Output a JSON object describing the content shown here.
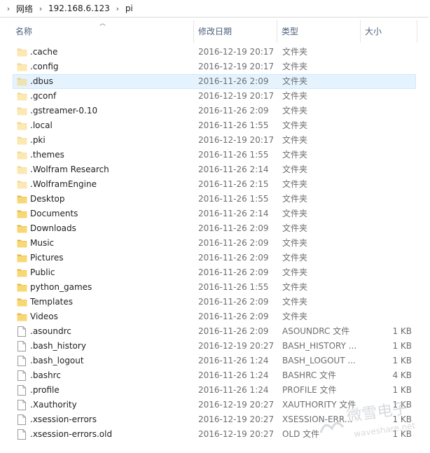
{
  "breadcrumb": {
    "items": [
      "网络",
      "192.168.6.123",
      "pi"
    ]
  },
  "columns": {
    "name": "名称",
    "date": "修改日期",
    "type": "类型",
    "size": "大小"
  },
  "selected_index": 2,
  "files": [
    {
      "icon": "folder-icon",
      "hidden": true,
      "name": ".cache",
      "date": "2016-12-19 20:17",
      "type": "文件夹",
      "size": ""
    },
    {
      "icon": "folder-icon",
      "hidden": true,
      "name": ".config",
      "date": "2016-12-19 20:17",
      "type": "文件夹",
      "size": ""
    },
    {
      "icon": "folder-icon",
      "hidden": true,
      "name": ".dbus",
      "date": "2016-11-26 2:09",
      "type": "文件夹",
      "size": ""
    },
    {
      "icon": "folder-icon",
      "hidden": true,
      "name": ".gconf",
      "date": "2016-12-19 20:17",
      "type": "文件夹",
      "size": ""
    },
    {
      "icon": "folder-icon",
      "hidden": true,
      "name": ".gstreamer-0.10",
      "date": "2016-11-26 2:09",
      "type": "文件夹",
      "size": ""
    },
    {
      "icon": "folder-icon",
      "hidden": true,
      "name": ".local",
      "date": "2016-11-26 1:55",
      "type": "文件夹",
      "size": ""
    },
    {
      "icon": "folder-icon",
      "hidden": true,
      "name": ".pki",
      "date": "2016-12-19 20:17",
      "type": "文件夹",
      "size": ""
    },
    {
      "icon": "folder-icon",
      "hidden": true,
      "name": ".themes",
      "date": "2016-11-26 1:55",
      "type": "文件夹",
      "size": ""
    },
    {
      "icon": "folder-icon",
      "hidden": true,
      "name": ".Wolfram Research",
      "date": "2016-11-26 2:14",
      "type": "文件夹",
      "size": ""
    },
    {
      "icon": "folder-icon",
      "hidden": true,
      "name": ".WolframEngine",
      "date": "2016-11-26 2:15",
      "type": "文件夹",
      "size": ""
    },
    {
      "icon": "folder-icon",
      "hidden": false,
      "name": "Desktop",
      "date": "2016-11-26 1:55",
      "type": "文件夹",
      "size": ""
    },
    {
      "icon": "folder-icon",
      "hidden": false,
      "name": "Documents",
      "date": "2016-11-26 2:14",
      "type": "文件夹",
      "size": ""
    },
    {
      "icon": "folder-icon",
      "hidden": false,
      "name": "Downloads",
      "date": "2016-11-26 2:09",
      "type": "文件夹",
      "size": ""
    },
    {
      "icon": "folder-icon",
      "hidden": false,
      "name": "Music",
      "date": "2016-11-26 2:09",
      "type": "文件夹",
      "size": ""
    },
    {
      "icon": "folder-icon",
      "hidden": false,
      "name": "Pictures",
      "date": "2016-11-26 2:09",
      "type": "文件夹",
      "size": ""
    },
    {
      "icon": "folder-icon",
      "hidden": false,
      "name": "Public",
      "date": "2016-11-26 2:09",
      "type": "文件夹",
      "size": ""
    },
    {
      "icon": "folder-icon",
      "hidden": false,
      "name": "python_games",
      "date": "2016-11-26 1:55",
      "type": "文件夹",
      "size": ""
    },
    {
      "icon": "folder-icon",
      "hidden": false,
      "name": "Templates",
      "date": "2016-11-26 2:09",
      "type": "文件夹",
      "size": ""
    },
    {
      "icon": "folder-icon",
      "hidden": false,
      "name": "Videos",
      "date": "2016-11-26 2:09",
      "type": "文件夹",
      "size": ""
    },
    {
      "icon": "file-icon",
      "hidden": false,
      "name": ".asoundrc",
      "date": "2016-11-26 2:09",
      "type": "ASOUNDRC 文件",
      "size": "1 KB"
    },
    {
      "icon": "file-icon",
      "hidden": false,
      "name": ".bash_history",
      "date": "2016-12-19 20:27",
      "type": "BASH_HISTORY ...",
      "size": "1 KB"
    },
    {
      "icon": "file-icon",
      "hidden": false,
      "name": ".bash_logout",
      "date": "2016-11-26 1:24",
      "type": "BASH_LOGOUT ...",
      "size": "1 KB"
    },
    {
      "icon": "file-icon",
      "hidden": false,
      "name": ".bashrc",
      "date": "2016-11-26 1:24",
      "type": "BASHRC 文件",
      "size": "4 KB"
    },
    {
      "icon": "file-icon",
      "hidden": false,
      "name": ".profile",
      "date": "2016-11-26 1:24",
      "type": "PROFILE 文件",
      "size": "1 KB"
    },
    {
      "icon": "file-icon",
      "hidden": false,
      "name": ".Xauthority",
      "date": "2016-12-19 20:27",
      "type": "XAUTHORITY 文件",
      "size": "1 KB"
    },
    {
      "icon": "file-icon",
      "hidden": false,
      "name": ".xsession-errors",
      "date": "2016-12-19 20:27",
      "type": "XSESSION-ERR...",
      "size": "1 KB"
    },
    {
      "icon": "file-icon",
      "hidden": false,
      "name": ".xsession-errors.old",
      "date": "2016-12-19 20:27",
      "type": "OLD 文件",
      "size": "1 KB"
    }
  ],
  "watermark": {
    "text_cn": "微雪电子",
    "text_en": "waveshare.net"
  },
  "colors": {
    "folder": "#f8d775",
    "folder_dark": "#e3b341",
    "selection_bg": "#e5f3ff",
    "selection_border": "#cce8ff",
    "header_text": "#4c607a"
  }
}
